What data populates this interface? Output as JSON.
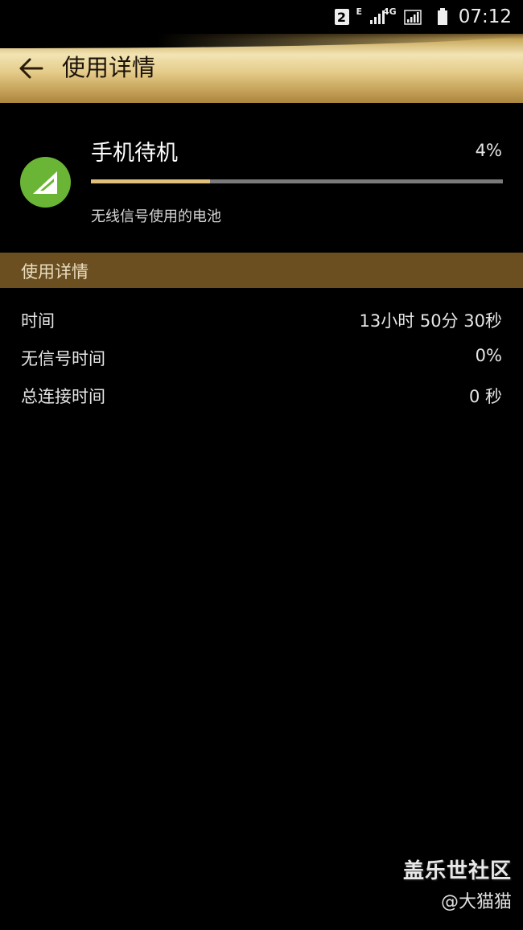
{
  "status_bar": {
    "sim_slot": "2",
    "network_e": "E",
    "network_4g": "4G",
    "time": "07:12"
  },
  "app_bar": {
    "title": "使用详情",
    "back_icon": "arrow-left-icon"
  },
  "battery_item": {
    "icon": "signal-icon",
    "icon_color": "#6bb536",
    "title": "手机待机",
    "percent_label": "4%",
    "progress_fraction": 0.29,
    "subtitle": "无线信号使用的电池"
  },
  "section": {
    "title": "使用详情"
  },
  "details": [
    {
      "label": "时间",
      "value": "13小时 50分 30秒"
    },
    {
      "label": "无信号时间",
      "value": "0%"
    },
    {
      "label": "总连接时间",
      "value": "0 秒"
    }
  ],
  "watermark": {
    "main": "盖乐世社区",
    "sub": "@大猫猫"
  },
  "colors": {
    "accent_gold": "#e0c07a",
    "section_header": "#6b4f20",
    "background": "#000000"
  }
}
